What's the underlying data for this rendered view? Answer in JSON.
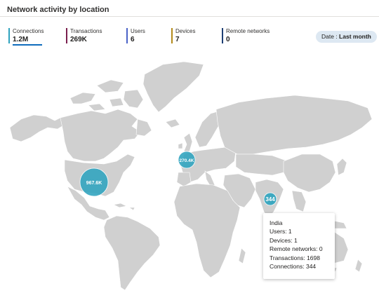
{
  "card": {
    "title": "Network activity by location"
  },
  "metrics": [
    {
      "label": "Connections",
      "value": "1.2M",
      "color": "#2ea3be"
    },
    {
      "label": "Transactions",
      "value": "269K",
      "color": "#7a1f4e"
    },
    {
      "label": "Users",
      "value": "6",
      "color": "#4a62c7"
    },
    {
      "label": "Devices",
      "value": "7",
      "color": "#b38a1a"
    },
    {
      "label": "Remote networks",
      "value": "0",
      "color": "#1e3f73"
    }
  ],
  "date_filter": {
    "label": "Date : ",
    "value": "Last month"
  },
  "map": {
    "bubble_color": "#2ea3be",
    "land_color": "#d0d0d0",
    "bubbles": [
      {
        "label": "967.6K",
        "location": "United States"
      },
      {
        "label": "270.4K",
        "location": "Europe"
      },
      {
        "label": "344",
        "location": "India"
      }
    ]
  },
  "tooltip": {
    "lines": [
      "India",
      "Users: 1",
      "Devices: 1",
      "Remote networks: 0",
      "Transactions: 1698",
      "Connections: 344"
    ]
  }
}
